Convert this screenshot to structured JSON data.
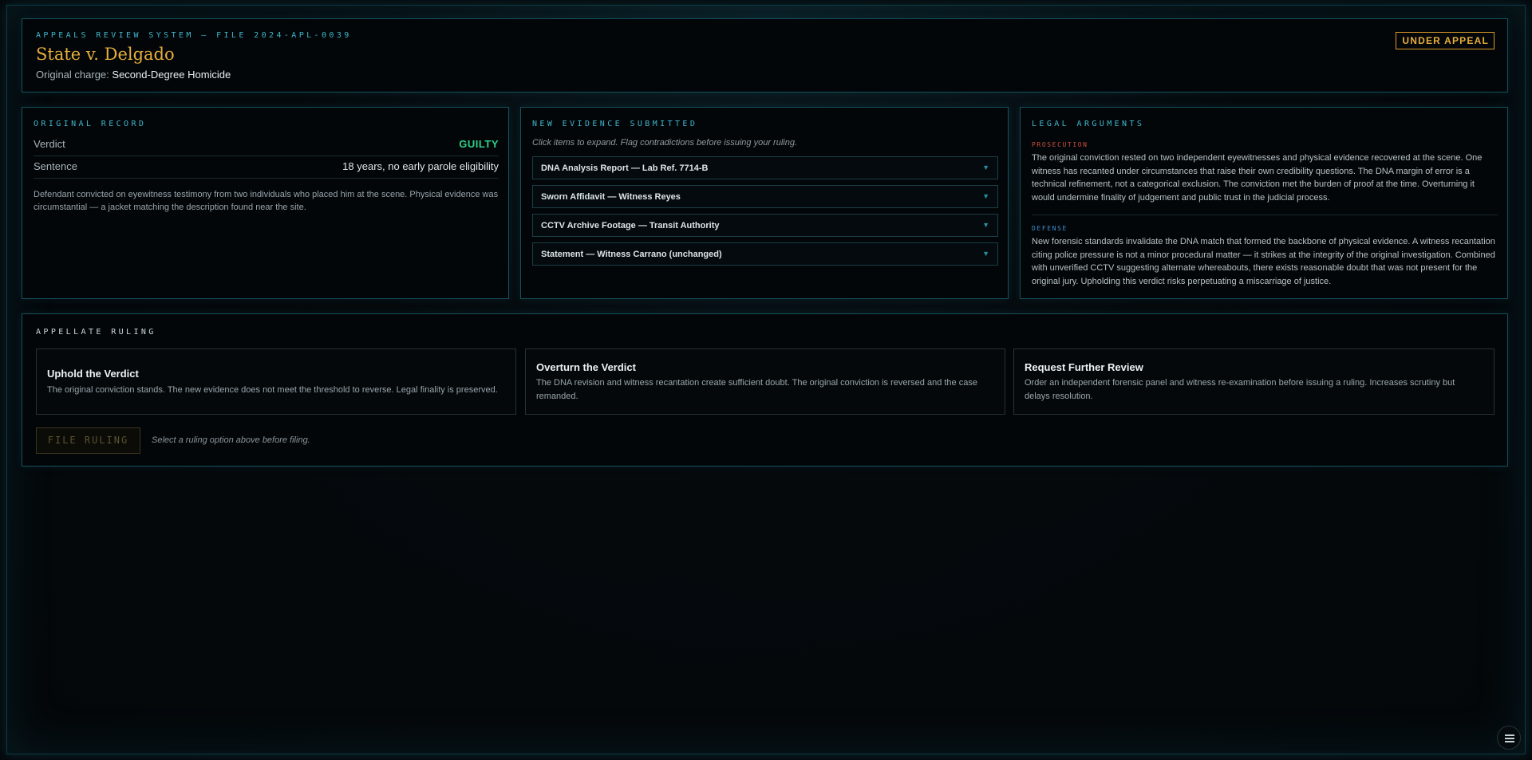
{
  "header": {
    "system_label": "APPEALS REVIEW SYSTEM — FILE 2024-APL-0039",
    "case_title": "State v. Delgado",
    "charge_label": "Original charge:",
    "charge_value": "Second-Degree Homicide",
    "status_badge": "UNDER APPEAL"
  },
  "record": {
    "title": "ORIGINAL RECORD",
    "rows": [
      {
        "label": "Verdict",
        "value": "GUILTY"
      },
      {
        "label": "Sentence",
        "value": "18 years, no early parole eligibility"
      }
    ],
    "note": "Defendant convicted on eyewitness testimony from two individuals who placed him at the scene. Physical evidence was circumstantial — a jacket matching the description found near the site."
  },
  "evidence": {
    "title": "NEW EVIDENCE SUBMITTED",
    "hint": "Click items to expand. Flag contradictions before issuing your ruling.",
    "items": [
      {
        "label": "DNA Analysis Report — Lab Ref. 7714-B"
      },
      {
        "label": "Sworn Affidavit — Witness Reyes"
      },
      {
        "label": "CCTV Archive Footage — Transit Authority"
      },
      {
        "label": "Statement — Witness Carrano (unchanged)"
      }
    ],
    "chevron": "▼"
  },
  "arguments": {
    "title": "LEGAL ARGUMENTS",
    "prosecution": {
      "label": "PROSECUTION",
      "text": "The original conviction rested on two independent eyewitnesses and physical evidence recovered at the scene. One witness has recanted under circumstances that raise their own credibility questions. The DNA margin of error is a technical refinement, not a categorical exclusion. The conviction met the burden of proof at the time. Overturning it would undermine finality of judgement and public trust in the judicial process."
    },
    "defense": {
      "label": "DEFENSE",
      "text": "New forensic standards invalidate the DNA match that formed the backbone of physical evidence. A witness recantation citing police pressure is not a minor procedural matter — it strikes at the integrity of the original investigation. Combined with unverified CCTV suggesting alternate whereabouts, there exists reasonable doubt that was not present for the original jury. Upholding this verdict risks perpetuating a miscarriage of justice."
    }
  },
  "ruling": {
    "title": "APPELLATE RULING",
    "options": [
      {
        "title": "Uphold the Verdict",
        "desc": "The original conviction stands. The new evidence does not meet the threshold to reverse. Legal finality is preserved."
      },
      {
        "title": "Overturn the Verdict",
        "desc": "The DNA revision and witness recantation create sufficient doubt. The original conviction is reversed and the case remanded."
      },
      {
        "title": "Request Further Review",
        "desc": "Order an independent forensic panel and witness re-examination before issuing a ruling. Increases scrutiny but delays resolution."
      }
    ],
    "file_button": "FILE RULING",
    "file_hint": "Select a ruling option above before filing."
  },
  "colors": {
    "accent_cyan": "#3fb6cc",
    "accent_gold": "#e7ad3d",
    "guilty_green": "#2ecf8a",
    "prosecution_red": "#d0503c",
    "defense_blue": "#3f8fd0"
  },
  "icons": {
    "menu": "hamburger-menu-icon"
  }
}
